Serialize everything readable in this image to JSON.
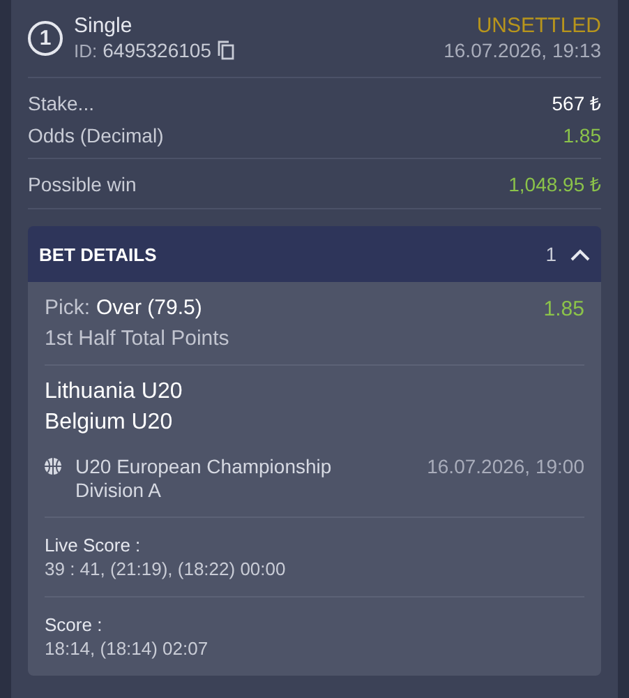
{
  "bet": {
    "number": "1",
    "type": "Single",
    "id_label": "ID:",
    "id": "6495326105",
    "status": "UNSETTLED",
    "placed": "16.07.2026, 19:13"
  },
  "summary": [
    {
      "label": "Stake...",
      "value": "567 ₺",
      "highlight": false
    },
    {
      "label": "Odds (Decimal)",
      "value": "1.85",
      "highlight": true
    }
  ],
  "possible_win": {
    "label": "Possible win",
    "value": "1,048.95 ₺"
  },
  "details": {
    "title": "BET DETAILS",
    "count": "1",
    "expanded": true,
    "pick_label": "Pick:",
    "pick": "Over (79.5)",
    "odds": "1.85",
    "market": "1st Half Total Points",
    "teams": [
      "Lithuania U20",
      "Belgium U20"
    ],
    "competition": "U20 European Championship Division A",
    "start": "16.07.2026, 19:00",
    "scores": [
      {
        "label": "Live Score :",
        "value": "39 : 41, (21:19), (18:22) 00:00"
      },
      {
        "label": "Score :",
        "value": "18:14, (18:14) 02:07"
      }
    ]
  }
}
